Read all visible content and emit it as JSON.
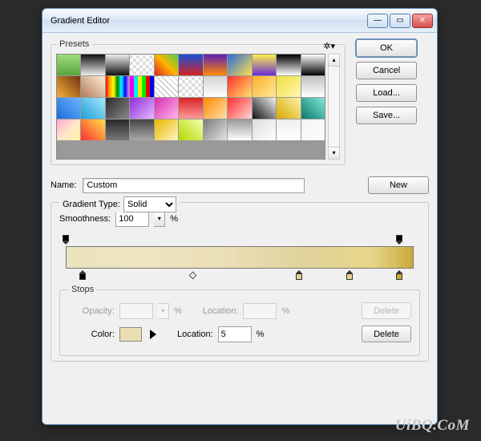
{
  "window": {
    "title": "Gradient Editor"
  },
  "buttons": {
    "ok": "OK",
    "cancel": "Cancel",
    "load": "Load...",
    "save": "Save...",
    "new": "New",
    "delete": "Delete"
  },
  "presets": {
    "legend": "Presets"
  },
  "name": {
    "label": "Name:",
    "value": "Custom"
  },
  "gradient_type": {
    "label": "Gradient Type:",
    "value": "Solid"
  },
  "smoothness": {
    "label": "Smoothness:",
    "value": "100",
    "unit": "%"
  },
  "stops": {
    "legend": "Stops",
    "opacity": {
      "label": "Opacity:",
      "value": "",
      "unit": "%"
    },
    "opacity_location": {
      "label": "Location:",
      "value": "",
      "unit": "%"
    },
    "color": {
      "label": "Color:",
      "swatch": "#eadfb2"
    },
    "color_location": {
      "label": "Location:",
      "value": "5",
      "unit": "%"
    }
  },
  "gradient_stops": {
    "opacity": [
      {
        "pos": 0
      },
      {
        "pos": 100
      }
    ],
    "color": [
      {
        "pos": 5,
        "color": "#ece3bf",
        "selected": true
      },
      {
        "pos": 70,
        "color": "#e1d29a"
      },
      {
        "pos": 85,
        "color": "#e7d588"
      },
      {
        "pos": 100,
        "color": "#c9a93a"
      }
    ],
    "midpoints": [
      {
        "pos": 38
      }
    ]
  },
  "preset_swatches": [
    "linear-gradient(#9edc7a,#5aa33e)",
    "linear-gradient(#111,#eee)",
    "linear-gradient(#eee,#111)",
    "repeating-conic-gradient(#fff 0 25%,#ddd 0 50%) 0/8px 8px",
    "linear-gradient(45deg,#d22,#ffb400,#4ad24a)",
    "linear-gradient(#1b4fd6,#d42323)",
    "linear-gradient(#5e1fb5,#ff8a00)",
    "linear-gradient(135deg,#2a6bdc,#ffe14a)",
    "linear-gradient(#fff04a,#6a2bd7)",
    "linear-gradient(#000,#fff)",
    "linear-gradient(#fff,#000)",
    "linear-gradient(45deg,#f7b03a,#6e3410)",
    "linear-gradient(45deg,#b57a52,#fff0df)",
    "linear-gradient(90deg,red,orange,yellow,green,cyan,blue,violet)",
    "linear-gradient(90deg,#e0e 16%,#0ee 16% 33%,#ee0 33% 50%,#0e0 50% 66%,#e00 66% 83%,#00e 83%)",
    "repeating-linear-gradient(45deg,#fff 0 4px,#bbb 4px 5px)",
    "repeating-conic-gradient(#fff 0 25%,#ddd 0 50%) 0/8px 8px",
    "linear-gradient(#d4d4d4,#fff)",
    "linear-gradient(135deg,#ff2e2e,#ffe566)",
    "linear-gradient(135deg,#ffaf2a,#ffe99a)",
    "linear-gradient(135deg,#efe03e,#fff7b0)",
    "linear-gradient(#c0c0c0,#fff)",
    "linear-gradient(45deg,#1c6bd8,#6eb6ff)",
    "linear-gradient(45deg,#1da0d8,#a6e7ff)",
    "linear-gradient(135deg,#2a2a2a,#888)",
    "linear-gradient(135deg,#8c2bd8,#e7b8ff)",
    "linear-gradient(135deg,#d82bb0,#ffb8ec)",
    "linear-gradient(#d82323,#ff9a9a)",
    "linear-gradient(135deg,#ff8a00,#ffe1aa)",
    "linear-gradient(135deg,#ff2e2e,#ffd5d5)",
    "linear-gradient(45deg,#111,#f2f2f2)",
    "linear-gradient(45deg,#d8a800,#fff2a8)",
    "linear-gradient(45deg,#077a6a,#85e6da)",
    "linear-gradient(135deg,#ffa3d1,#ffe6c8,#fff2a8)",
    "linear-gradient(45deg,#ff2e2e,#ffe14a)",
    "linear-gradient(#2a2a2a,#777)",
    "linear-gradient(#444,#aaa)",
    "linear-gradient(135deg,#e8b500,#fff7c0)",
    "linear-gradient(45deg,#b8d800,#f0ffb0)",
    "linear-gradient(135deg,#7a7a7a,#e5e5e5)",
    "linear-gradient(#999,#fff)",
    "linear-gradient(135deg,#ddd,#fff)",
    "linear-gradient(#eee,#fff)",
    "linear-gradient(135deg,#f2f2f2,#fff)"
  ],
  "watermark": "UiBQ.CoM"
}
